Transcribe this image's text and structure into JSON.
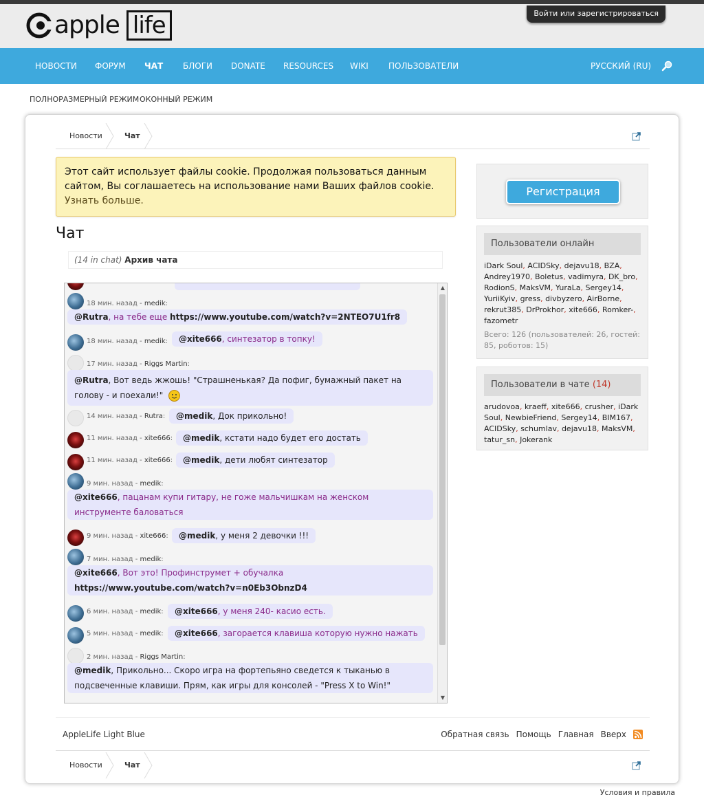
{
  "header": {
    "logo_word": "apple",
    "logo_box": "life",
    "login": "Войти или зарегистрироваться"
  },
  "nav": {
    "items": [
      "Новости",
      "Форум",
      "Чат",
      "Блоги",
      "Donate",
      "Resources",
      "Wiki",
      "Пользователи"
    ],
    "language": "Русский (RU)"
  },
  "subnav": [
    "Полноразмерный режим",
    "Оконный режим"
  ],
  "breadcrumb": [
    "Новости",
    "Чат"
  ],
  "cookie": {
    "text": "Этот сайт использует файлы cookie. Продолжая пользоваться данным сайтом, Вы соглашаетесь на использование нами Ваших файлов cookie.",
    "link": "Узнать больше."
  },
  "page_title": "Чат",
  "chat_head": {
    "count": "(14 in chat)",
    "archive": "Архив чата"
  },
  "messages": [
    {
      "time": "18 мин. назад",
      "user": "medik",
      "mention": "@Rutra",
      "text": ", на тебе еще ",
      "link": "https://www.youtube.com/watch?v=2NTEO7U1fr8"
    },
    {
      "time": "18 мин. назад",
      "user": "medik",
      "mention": "@xite666",
      "text": ", синтезатор в топку!"
    },
    {
      "time": "17 мин. назад",
      "user": "Riggs Martin",
      "mention": "@Rutra",
      "text": ", Вот ведь жжошь! \"Страшненькая? Да пофиг, бумажный пакет на голову - и поехали!\""
    },
    {
      "time": "14 мин. назад",
      "user": "Rutra",
      "mention": "@medik",
      "text": ", Док прикольно!"
    },
    {
      "time": "11 мин. назад",
      "user": "xite666",
      "mention": "@medik",
      "text": ", кстати надо будет его достать"
    },
    {
      "time": "11 мин. назад",
      "user": "xite666",
      "mention": "@medik",
      "text": ", дети любят синтезатор"
    },
    {
      "time": "9 мин. назад",
      "user": "medik",
      "mention": "@xite666",
      "text": ", пацанам купи гитару, не гоже мальчишкам на женском инструменте баловаться"
    },
    {
      "time": "9 мин. назад",
      "user": "xite666",
      "mention": "@medik",
      "text": ", у меня 2 девочки !!!"
    },
    {
      "time": "7 мин. назад",
      "user": "medik",
      "mention": "@xite666",
      "text": ", Вот это! Профинструмет + обучалка ",
      "link": "https://www.youtube.com/watch?v=n0Eb3ObnzD4"
    },
    {
      "time": "6 мин. назад",
      "user": "medik",
      "mention": "@xite666",
      "text": ", у меня 240- касио есть."
    },
    {
      "time": "5 мин. назад",
      "user": "medik",
      "mention": "@xite666",
      "text": ", загорается клавиша которую нужно нажать"
    },
    {
      "time": "2 мин. назад",
      "user": "Riggs Martin",
      "mention": "@medik",
      "text": ", Прикольно... Скоро игра на фортепьяно сведется к тыканью в подсвеченные клавиши. Прям, как игры для консолей - \"Press X to Win!\""
    }
  ],
  "sidebar": {
    "register": "Регистрация",
    "online_title": "Пользователи онлайн",
    "online_users": [
      "iDark Soul",
      "ACIDSky",
      "dejavu18",
      "BZA",
      "Andrey1970",
      "Boletus",
      "vadimyra",
      "DK_bro",
      "RodionS",
      "MaksVM",
      "YuraLa",
      "Sergey14",
      "YuriiKyiv",
      "gress",
      "divbyzero",
      "AirBorne",
      "rekrut385",
      "DrProkhor",
      "xite666",
      "Romker-",
      "fazometr"
    ],
    "online_stats": "Всего: 126 (пользователей: 26, гостей: 85, роботов: 15)",
    "chat_title": "Пользователи в чате",
    "chat_count": "(14)",
    "chat_users": [
      "arudovoa",
      "kraeff",
      "xite666",
      "crusher",
      "iDark Soul",
      "NewbieFriend",
      "Sergey14",
      "BIM167",
      "ACIDSky",
      "schumlav",
      "dejavu18",
      "MaksVM",
      "tatur_sn",
      "Jokerank"
    ]
  },
  "footer": {
    "style": "AppleLife Light Blue",
    "links": [
      "Обратная связь",
      "Помощь",
      "Главная",
      "Вверх"
    ],
    "terms": "Условия и правила"
  },
  "colors": {
    "accent": "#3ea9dd",
    "bubble": "#e6e6fb",
    "highlight": "#8a2a8a",
    "count_red": "#c0392b"
  }
}
